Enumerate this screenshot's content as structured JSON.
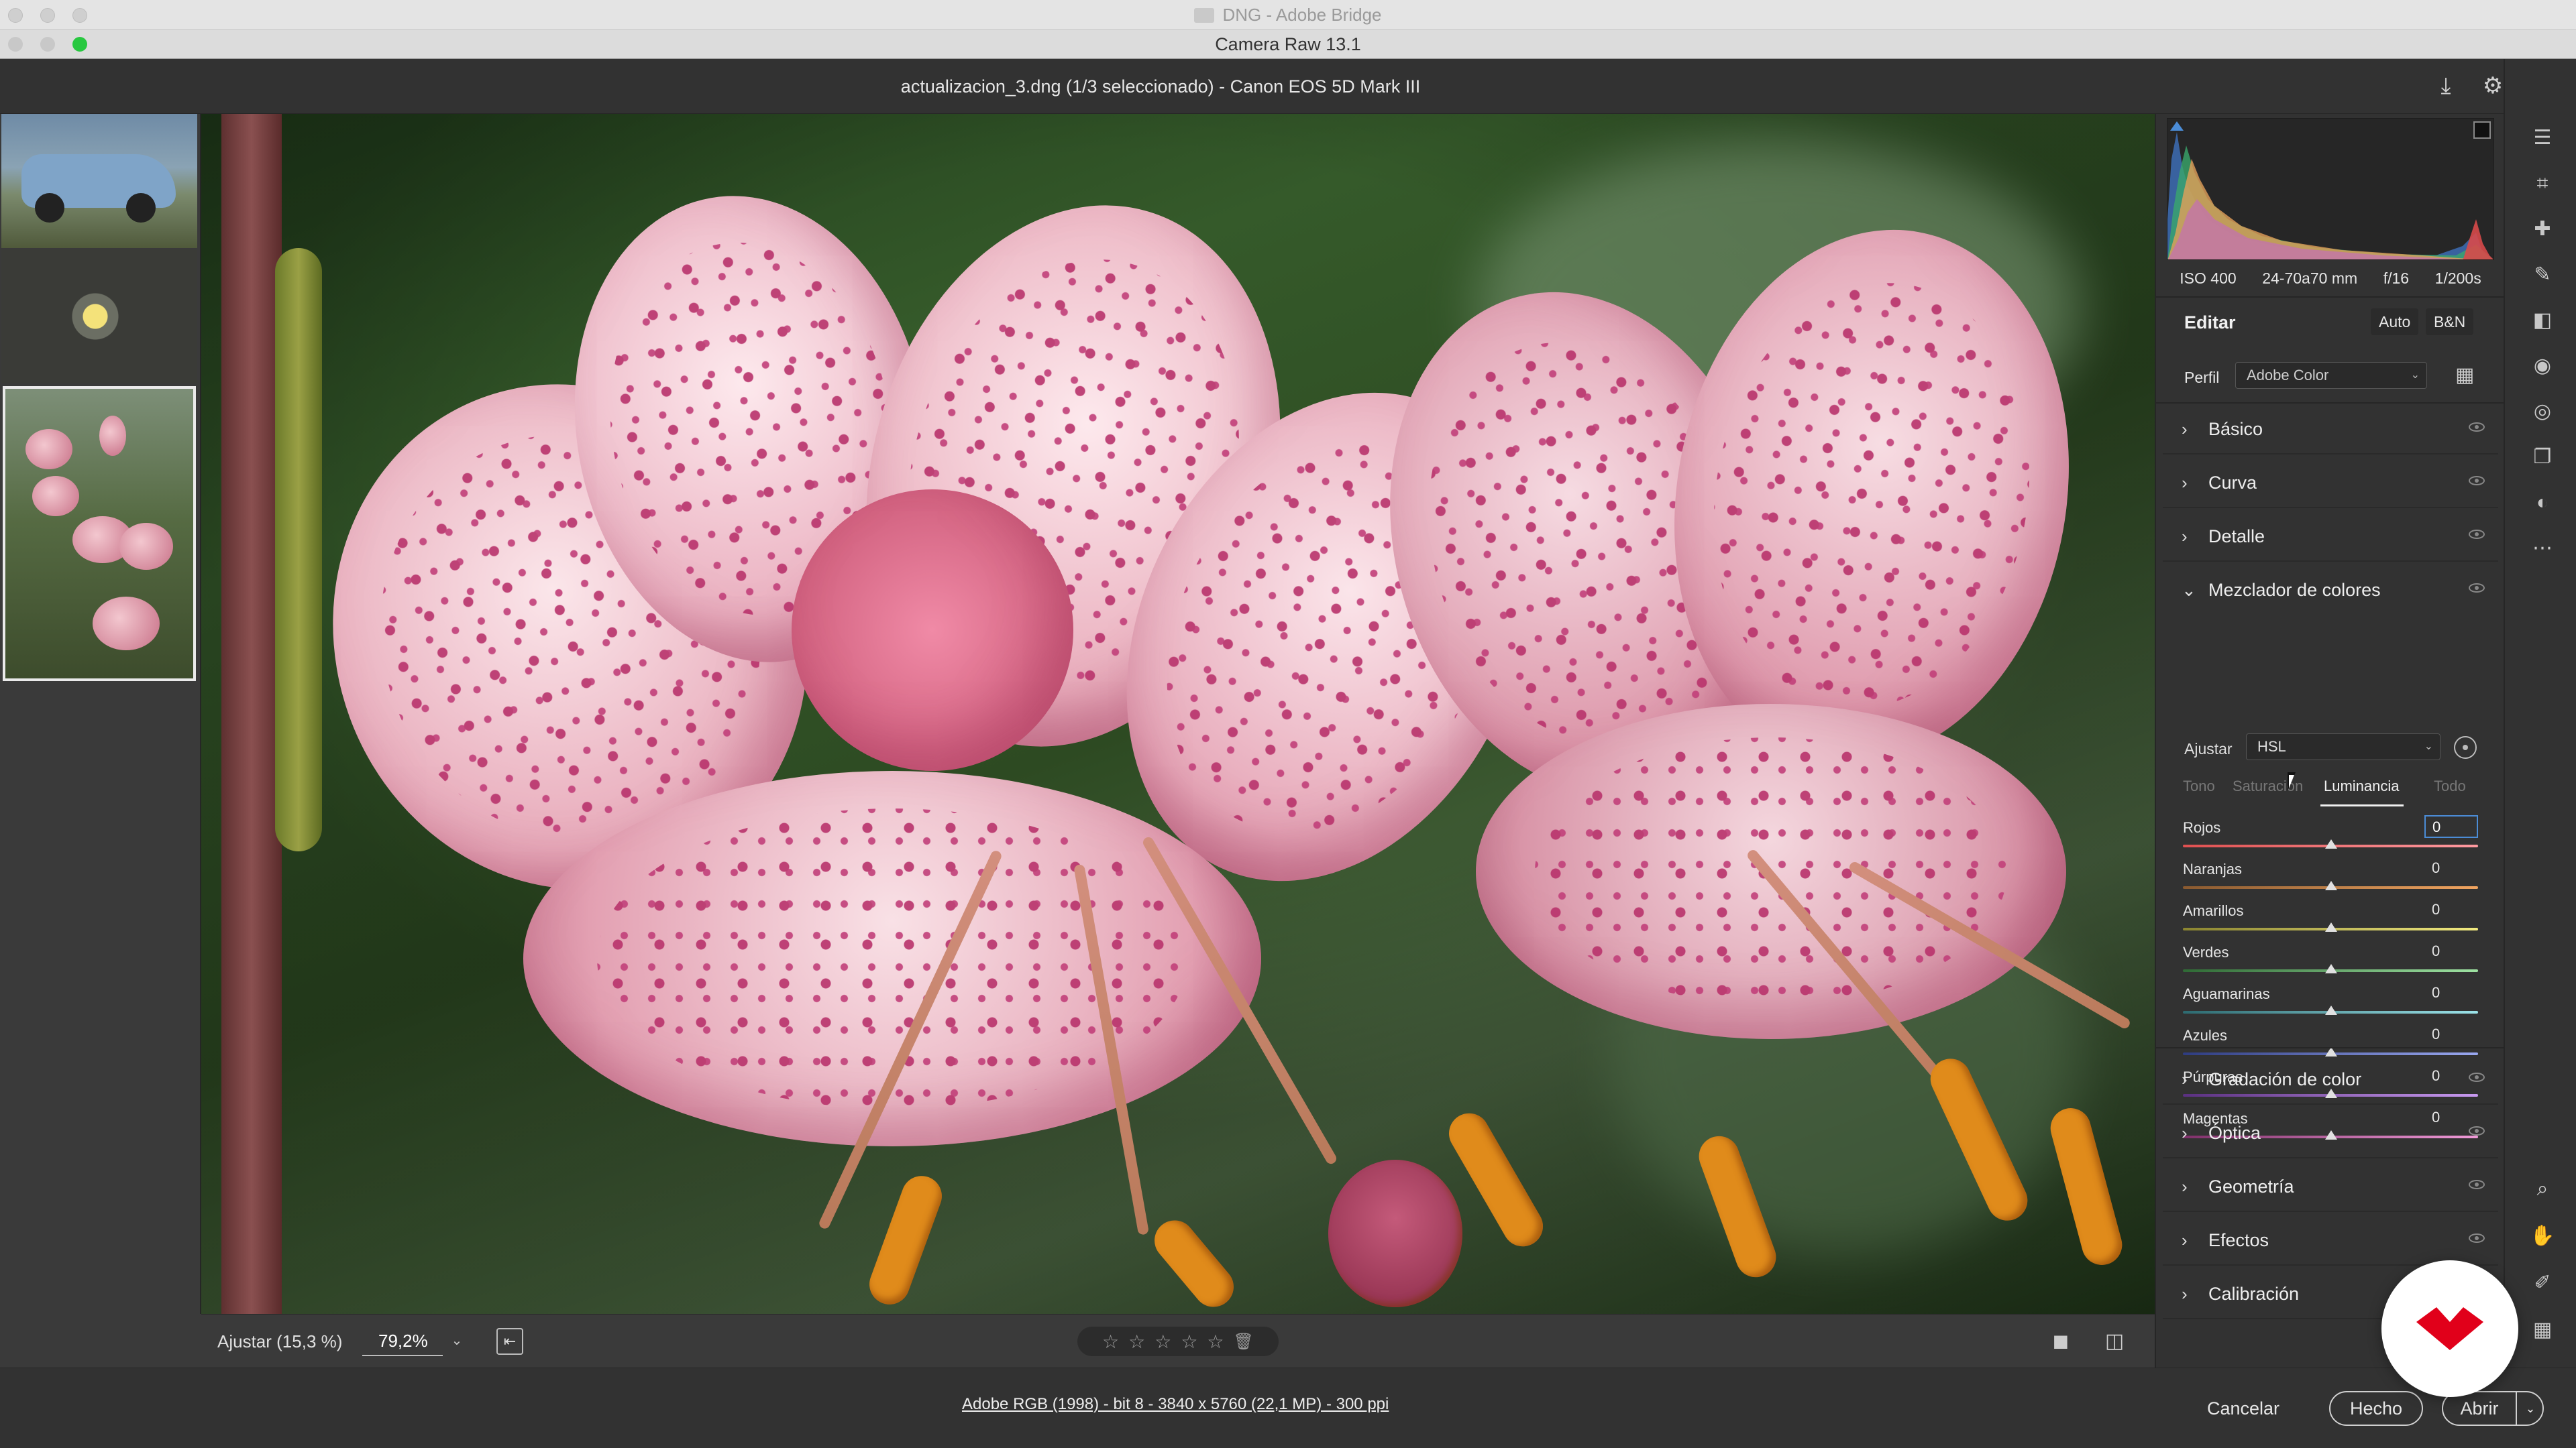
{
  "bridge_window": {
    "title": "DNG - Adobe Bridge"
  },
  "acr_window": {
    "title": "Camera Raw 13.1"
  },
  "header": {
    "file_title": "actualizacion_3.dng (1/3 seleccionado) -  Canon EOS 5D Mark III",
    "icons": [
      "save-icon",
      "gear-icon",
      "fullscreen-icon"
    ]
  },
  "filmstrip": {
    "thumbnails": [
      {
        "subject": "truck",
        "selected": false
      },
      {
        "subject": "yellow-flower",
        "selected": false
      },
      {
        "subject": "pink-lilies",
        "selected": true
      }
    ]
  },
  "histogram": {
    "exif": {
      "iso": "ISO 400",
      "lens": "24-70a70 mm",
      "aperture": "f/16",
      "shutter": "1/200s"
    }
  },
  "edit": {
    "title": "Editar",
    "auto_label": "Auto",
    "bw_label": "B&N",
    "profile_label": "Perfil",
    "profile_value": "Adobe Color"
  },
  "sections_top": [
    {
      "name": "Básico",
      "expanded": false
    },
    {
      "name": "Curva",
      "expanded": false
    },
    {
      "name": "Detalle",
      "expanded": false
    }
  ],
  "color_mixer": {
    "title": "Mezclador de colores",
    "adjust_label": "Ajustar",
    "adjust_value": "HSL",
    "tabs": [
      {
        "label": "Tono",
        "active": false
      },
      {
        "label": "Saturación",
        "active": false
      },
      {
        "label": "Luminancia",
        "active": true
      },
      {
        "label": "Todo",
        "active": false
      }
    ],
    "sliders": [
      {
        "label": "Rojos",
        "value": "0",
        "focused": true,
        "color_from": "#e05050",
        "color_to": "#ff9aa0"
      },
      {
        "label": "Naranjas",
        "value": "0",
        "focused": false,
        "color_from": "#8a5a30",
        "color_to": "#f0a460"
      },
      {
        "label": "Amarillos",
        "value": "0",
        "focused": false,
        "color_from": "#8a8430",
        "color_to": "#f2ea80"
      },
      {
        "label": "Verdes",
        "value": "0",
        "focused": false,
        "color_from": "#2f6a35",
        "color_to": "#9ee2a2"
      },
      {
        "label": "Aguamarinas",
        "value": "0",
        "focused": false,
        "color_from": "#2d6a70",
        "color_to": "#9be2e8"
      },
      {
        "label": "Azules",
        "value": "0",
        "focused": false,
        "color_from": "#2e3c80",
        "color_to": "#9aa8f0"
      },
      {
        "label": "Púrpuras",
        "value": "0",
        "focused": false,
        "color_from": "#5a3080",
        "color_to": "#c89af0"
      },
      {
        "label": "Magentas",
        "value": "0",
        "focused": false,
        "color_from": "#80306a",
        "color_to": "#f09ad8"
      }
    ]
  },
  "sections_bottom": [
    {
      "name": "Gradación de color",
      "expanded": false
    },
    {
      "name": "Óptica",
      "expanded": false
    },
    {
      "name": "Geometría",
      "expanded": false
    },
    {
      "name": "Efectos",
      "expanded": false
    },
    {
      "name": "Calibración",
      "expanded": false
    }
  ],
  "bottom_toolbar": {
    "fit_label": "Ajustar (15,3 %)",
    "zoom_value": "79,2%",
    "stars": [
      "☆",
      "☆",
      "☆",
      "☆",
      "☆"
    ],
    "delete_icon": "trash-icon"
  },
  "status_bar": {
    "workflow_text": "Adobe RGB (1998) - bit 8 - 3840 x 5760 (22,1 MP) - 300 ppi",
    "cancel_label": "Cancelar",
    "done_label": "Hecho",
    "open_label": "Abrir"
  },
  "tool_strip": {
    "tools": [
      "edit-sliders-icon",
      "crop-icon",
      "healing-icon",
      "brush-icon",
      "gradient-icon",
      "radial-icon",
      "redeye-icon",
      "snapshots-icon",
      "presets-icon",
      "more-icon"
    ],
    "bottom_tools": [
      "zoom-icon",
      "hand-icon",
      "color-sampler-icon",
      "grid-icon"
    ]
  },
  "colors": {
    "accent": "#4b8cd6",
    "panel_bg": "#323232",
    "watermark_red": "#e1001a",
    "traffic_close": "#fe5f57",
    "traffic_min": "#febc2e",
    "traffic_max": "#28c840"
  }
}
